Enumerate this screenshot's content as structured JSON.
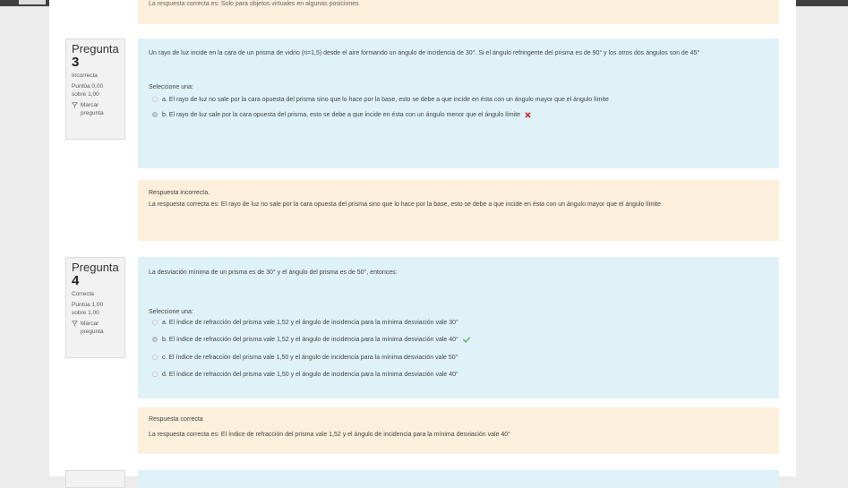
{
  "prev_feedback": {
    "text": "La respuesta correcta es: Solo para objetos virtuales en algunas posiciones"
  },
  "questions": [
    {
      "word": "Pregunta",
      "number": "3",
      "state": "Incorrecta",
      "score_line1": "Puntúa 0,00",
      "score_line2": "sobre 1,00",
      "flag_line1": "Marcar",
      "flag_line2": "pregunta",
      "text": "Un rayo de luz incide en la cara de un prisma de vidrio (n=1,5) desde el aire formando un ángulo de incidencia de 30°. Si el ángulo refringente del prisma es de 90° y los otros dos ángulos son de 45°",
      "prompt": "Seleccione una:",
      "options": [
        "a. El rayo de luz no sale por la cara opuesta del prisma sino que lo hace por la base, esto se debe a que incide en ésta con un ángulo mayor que el ángulo límite",
        "b. El rayo de luz sale por la cara opuesta del prisma, esto se debe a que incide en ésta con un ángulo menor que el ángulo límite"
      ],
      "feedback_status": "Respuesta incorrecta.",
      "feedback_correct": "La respuesta correcta es: El rayo de luz no sale por la cara opuesta del prisma sino que lo hace por la base, esto se debe a que incide en ésta con un ángulo mayor que el ángulo límite"
    },
    {
      "word": "Pregunta",
      "number": "4",
      "state": "Correcta",
      "score_line1": "Puntúa 1,00",
      "score_line2": "sobre 1,00",
      "flag_line1": "Marcar",
      "flag_line2": "pregunta",
      "text": "La desviación mínima de un prisma es de 30° y el ángulo del prisma es de 50°, entonces:",
      "prompt": "Seleccione una:",
      "options": [
        "a. El índice de refracción del prisma vale 1,52 y el ángulo de incidencia para la mínima desviación vale 30°",
        "b. El índice de refracción del prisma vale 1,52 y el ángulo de incidencia para la mínima desviación vale 40°",
        "c. El índice de refracción del prisma vale 1,50 y el ángulo de incidencia para la mínima desviación vale 50°",
        "d. El índice de refracción del prisma vale 1,50 y el ángulo de incidencia para la mínima desviación vale 40°"
      ],
      "feedback_status": "Respuesta correcta",
      "feedback_correct": "La respuesta correcta es: El índice de refracción del prisma vale 1,52 y el ángulo de incidencia para la mínima desviación vale 40°"
    }
  ],
  "colors": {
    "formulation_bg": "#def2f8",
    "feedback_bg": "#fcefdc",
    "incorrect_mark": "#c9302c",
    "correct_mark": "#5cb85c"
  }
}
